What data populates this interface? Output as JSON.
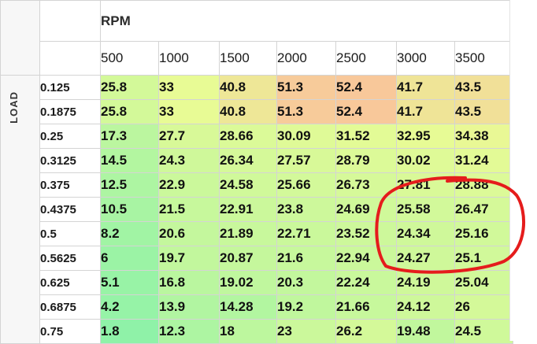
{
  "table": {
    "column_axis_label": "RPM",
    "row_axis_label": "LOAD",
    "columns": [
      "500",
      "1000",
      "1500",
      "2000",
      "2500",
      "3000",
      "3500"
    ],
    "rows": [
      {
        "load": "0.125",
        "values": [
          "25.8",
          "33",
          "40.8",
          "51.3",
          "52.4",
          "41.7",
          "43.5"
        ]
      },
      {
        "load": "0.1875",
        "values": [
          "25.8",
          "33",
          "40.8",
          "51.3",
          "52.4",
          "41.7",
          "43.5"
        ]
      },
      {
        "load": "0.25",
        "values": [
          "17.3",
          "27.7",
          "28.66",
          "30.09",
          "31.52",
          "32.95",
          "34.38"
        ]
      },
      {
        "load": "0.3125",
        "values": [
          "14.5",
          "24.3",
          "26.34",
          "27.57",
          "28.79",
          "30.02",
          "31.24"
        ]
      },
      {
        "load": "0.375",
        "values": [
          "12.5",
          "22.9",
          "24.58",
          "25.66",
          "26.73",
          "27.81",
          "28.88"
        ]
      },
      {
        "load": "0.4375",
        "values": [
          "10.5",
          "21.5",
          "22.91",
          "23.8",
          "24.69",
          "25.58",
          "26.47"
        ]
      },
      {
        "load": "0.5",
        "values": [
          "8.2",
          "20.6",
          "21.89",
          "22.71",
          "23.52",
          "24.34",
          "25.16"
        ]
      },
      {
        "load": "0.5625",
        "values": [
          "6",
          "19.7",
          "20.87",
          "21.6",
          "22.94",
          "24.27",
          "25.1"
        ]
      },
      {
        "load": "0.625",
        "values": [
          "5.1",
          "16.8",
          "19.02",
          "20.3",
          "22.24",
          "24.19",
          "25.04"
        ]
      },
      {
        "load": "0.6875",
        "values": [
          "4.2",
          "13.9",
          "14.28",
          "19.2",
          "21.66",
          "24.12",
          "26"
        ]
      },
      {
        "load": "0.75",
        "values": [
          "1.8",
          "12.3",
          "18",
          "23",
          "26.2",
          "19.48",
          "24.5"
        ]
      }
    ]
  },
  "heat_colors": {
    "low": "#8ff2a8",
    "mid": "#e8fb95",
    "high": "#f8c89a"
  },
  "annotation": {
    "shape": "freehand-circle",
    "color": "#e51c1c",
    "encircles_columns": [
      "3000",
      "3500"
    ],
    "encircles_rows": [
      "0.375",
      "0.4375",
      "0.5",
      "0.5625"
    ]
  }
}
